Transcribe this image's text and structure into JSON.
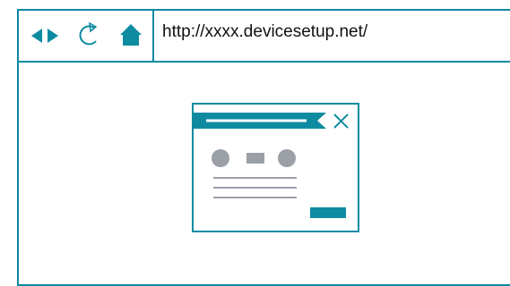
{
  "browser": {
    "address_bar": {
      "url": "http://xxxx.devicesetup.net/"
    },
    "nav_buttons": {
      "back_forward_icon": "arrows-left-right-icon",
      "refresh_icon": "refresh-icon",
      "home_icon": "home-icon"
    }
  },
  "colors": {
    "accent": "#0e8ba1",
    "gray": "#9aa0a6"
  },
  "content": {
    "illustration": "setup-window-icon",
    "dialog_close_icon": "close-icon"
  }
}
